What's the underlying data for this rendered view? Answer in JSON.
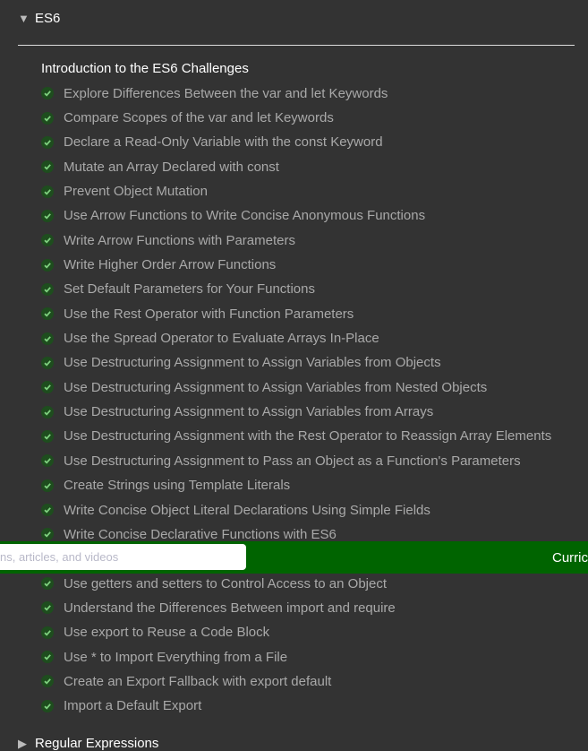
{
  "section": {
    "title": "ES6",
    "expanded_icon": "triangle-down-icon"
  },
  "intro": "Introduction to the ES6 Challenges",
  "challenges_before": [
    "Explore Differences Between the var and let Keywords",
    "Compare Scopes of the var and let Keywords",
    "Declare a Read-Only Variable with the const Keyword",
    "Mutate an Array Declared with const",
    "Prevent Object Mutation",
    "Use Arrow Functions to Write Concise Anonymous Functions",
    "Write Arrow Functions with Parameters",
    "Write Higher Order Arrow Functions",
    "Set Default Parameters for Your Functions",
    "Use the Rest Operator with Function Parameters",
    "Use the Spread Operator to Evaluate Arrays In-Place",
    "Use Destructuring Assignment to Assign Variables from Objects",
    "Use Destructuring Assignment to Assign Variables from Nested Objects",
    "Use Destructuring Assignment to Assign Variables from Arrays",
    "Use Destructuring Assignment with the Rest Operator to Reassign Array Elements",
    "Use Destructuring Assignment to Pass an Object as a Function's Parameters",
    "Create Strings using Template Literals",
    "Write Concise Object Literal Declarations Using Simple Fields",
    "Write Concise Declarative Functions with ES6"
  ],
  "challenges_after": [
    "Use getters and setters to Control Access to an Object",
    "Understand the Differences Between import and require",
    "Use export to Reuse a Code Block",
    "Use * to Import Everything from a File",
    "Create an Export Fallback with export default",
    "Import a Default Export"
  ],
  "navbar": {
    "search_placeholder": "ns, articles, and videos",
    "curriculum_label": "Curric",
    "color": "#006400"
  },
  "next_section": {
    "title": "Regular Expressions",
    "collapsed_icon": "triangle-right-icon"
  },
  "colors": {
    "background": "#333333",
    "check": "#1e4d1e",
    "text": "#a9a9a9"
  }
}
